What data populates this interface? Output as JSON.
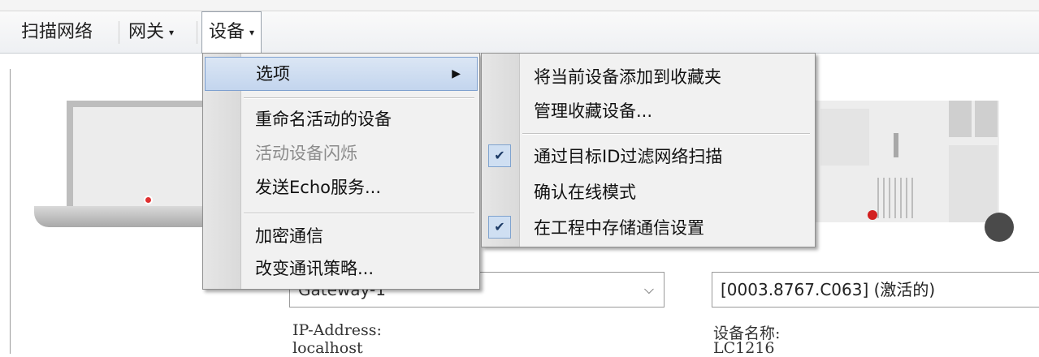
{
  "menubar": {
    "items": [
      {
        "label": "扫描网络"
      },
      {
        "label": "网关",
        "caret": "▾"
      },
      {
        "label": "设备",
        "caret": "▾"
      }
    ]
  },
  "device_menu": {
    "items": [
      {
        "label": "选项",
        "submenu_arrow": "▶"
      },
      {
        "label": "重命名活动的设备"
      },
      {
        "label": "活动设备闪烁"
      },
      {
        "label": "发送Echo服务..."
      },
      {
        "label": "加密通信"
      },
      {
        "label": "改变通讯策略..."
      }
    ]
  },
  "options_submenu": {
    "items": [
      {
        "label": "将当前设备添加到收藏夹"
      },
      {
        "label": "管理收藏设备..."
      },
      {
        "label": "通过目标ID过滤网络扫描",
        "check": "✔"
      },
      {
        "label": "确认在线模式"
      },
      {
        "label": "在工程中存储通信设置",
        "check": "✔"
      }
    ]
  },
  "form": {
    "gateway_value": "Gateway-1",
    "gateway_chevron": "⌵",
    "device_value": "[0003.8767.C063] (激活的)",
    "ip_label": "IP-Address:",
    "ip_value": "localhost",
    "device_name_label": "设备名称:",
    "device_name_value": "LC1216"
  }
}
